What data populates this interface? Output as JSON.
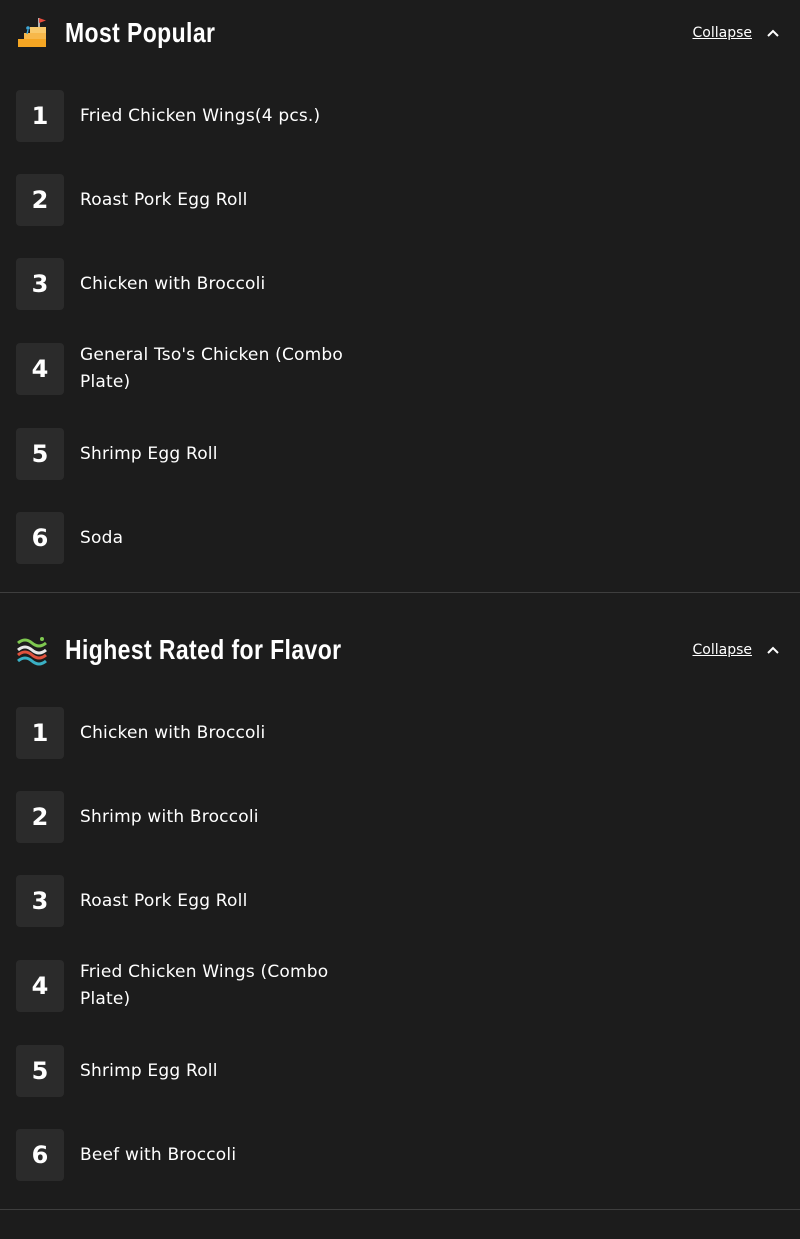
{
  "sections": [
    {
      "icon": "stairs-flag-icon",
      "title": "Most Popular",
      "collapse_label": "Collapse",
      "items": [
        {
          "rank": "1",
          "name": "Fried Chicken Wings(4 pcs.)"
        },
        {
          "rank": "2",
          "name": "Roast Pork Egg Roll"
        },
        {
          "rank": "3",
          "name": "Chicken with Broccoli"
        },
        {
          "rank": "4",
          "name": "General Tso's Chicken (Combo Plate)"
        },
        {
          "rank": "5",
          "name": "Shrimp Egg Roll"
        },
        {
          "rank": "6",
          "name": "Soda"
        }
      ]
    },
    {
      "icon": "flavor-waves-icon",
      "title": "Highest Rated for Flavor",
      "collapse_label": "Collapse",
      "items": [
        {
          "rank": "1",
          "name": "Chicken with Broccoli"
        },
        {
          "rank": "2",
          "name": "Shrimp with Broccoli"
        },
        {
          "rank": "3",
          "name": "Roast Pork Egg Roll"
        },
        {
          "rank": "4",
          "name": "Fried Chicken Wings (Combo Plate)"
        },
        {
          "rank": "5",
          "name": "Shrimp Egg Roll"
        },
        {
          "rank": "6",
          "name": "Beef with Broccoli"
        }
      ]
    }
  ]
}
